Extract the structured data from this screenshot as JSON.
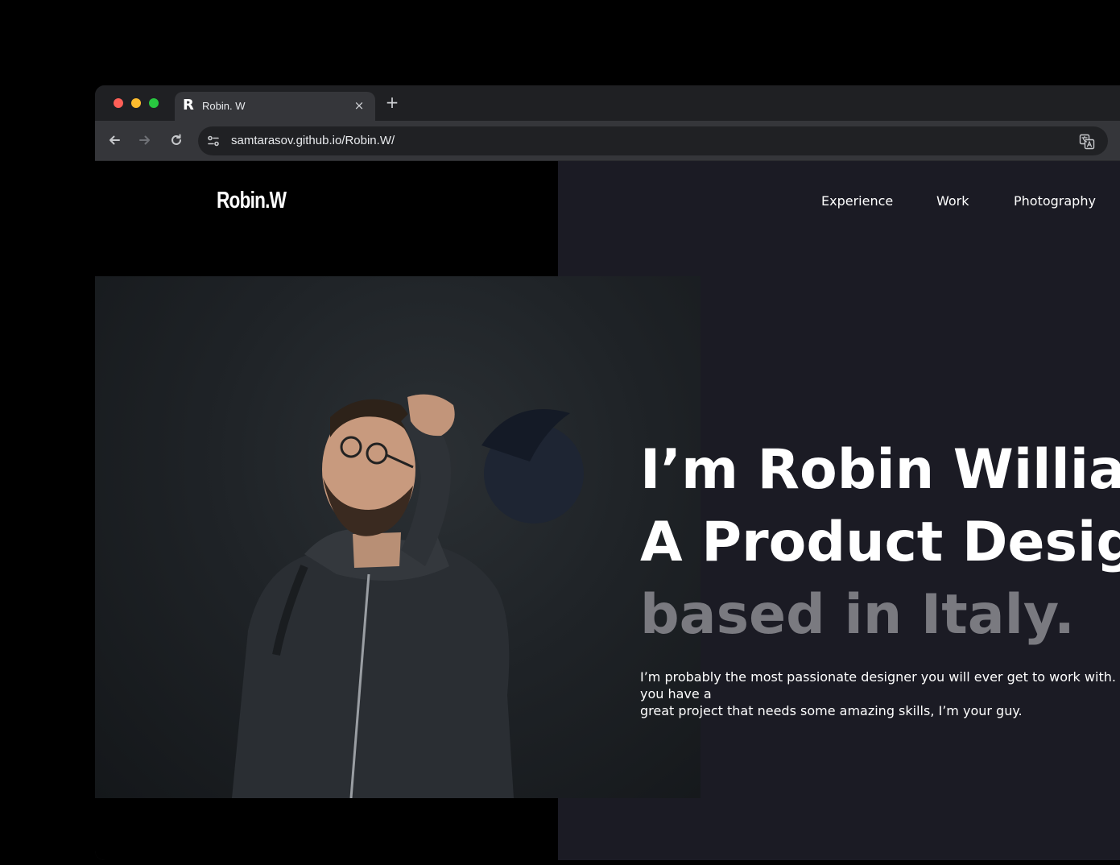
{
  "browser": {
    "tab_title": "Robin. W",
    "tab_favicon": "R",
    "tab_close": "×",
    "new_tab": "+",
    "url": "samtarasov.github.io/Robin.W/"
  },
  "site": {
    "logo": "Robin.W",
    "nav": [
      "Experience",
      "Work",
      "Photography"
    ],
    "headline": [
      "I’m Robin William,",
      "A Product Designer",
      "based in Italy."
    ],
    "intro": [
      "I’m probably the most passionate designer you will ever get to work with. If you have a",
      "great project that needs some amazing skills, I’m your guy."
    ]
  }
}
